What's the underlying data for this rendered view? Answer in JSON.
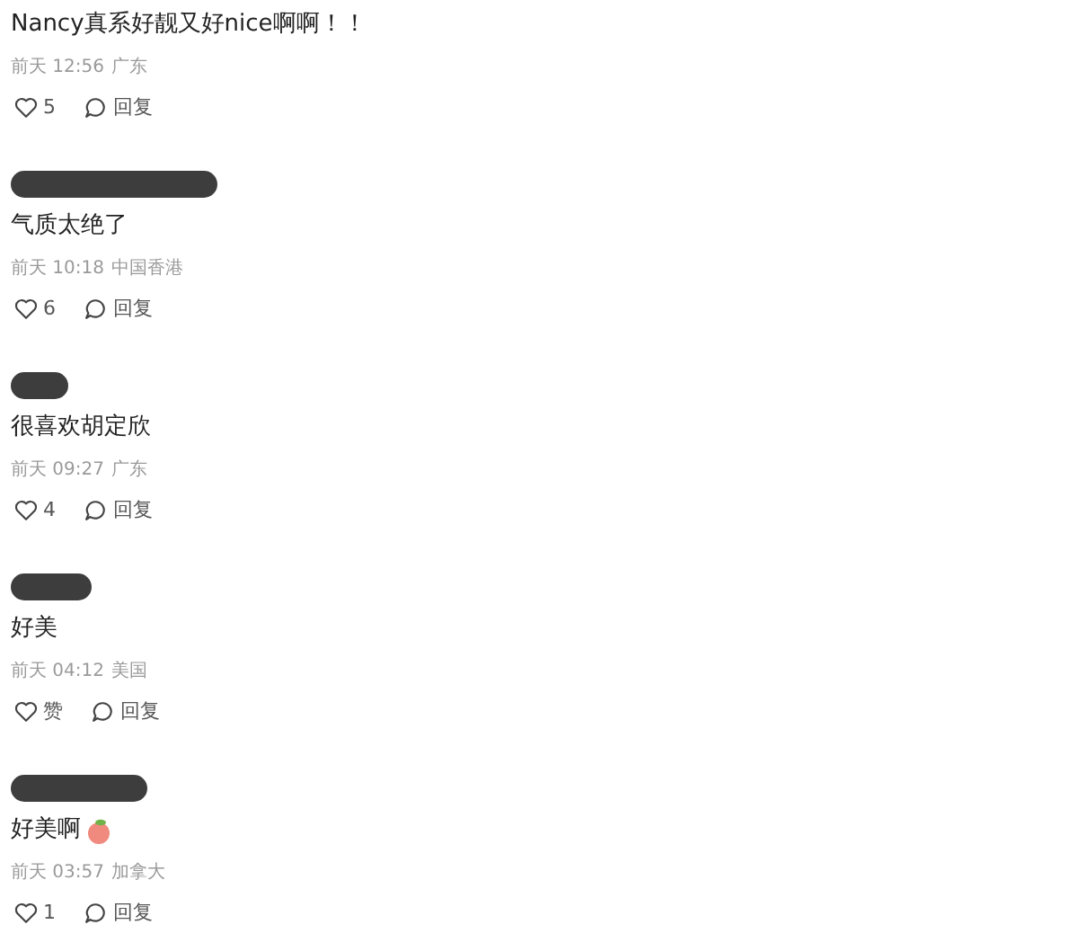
{
  "comments": [
    {
      "text": "Nancy真系好靓又好nice啊啊！！",
      "time": "前天 12:56",
      "location": "广东",
      "likes": "5",
      "reply": "回复"
    },
    {
      "author_hidden": true,
      "text": "气质太绝了",
      "time": "前天 10:18",
      "location": "中国香港",
      "likes": "6",
      "reply": "回复"
    },
    {
      "author_hidden": true,
      "text": "很喜欢胡定欣",
      "time": "前天 09:27",
      "location": "广东",
      "likes": "4",
      "reply": "回复"
    },
    {
      "author_hidden": true,
      "text": "好美",
      "time": "前天 04:12",
      "location": "美国",
      "likes": "赞",
      "reply": "回复"
    },
    {
      "author_hidden": true,
      "text": "好美啊",
      "emoji": true,
      "time": "前天 03:57",
      "location": "加拿大",
      "likes": "1",
      "reply": "回复"
    }
  ]
}
